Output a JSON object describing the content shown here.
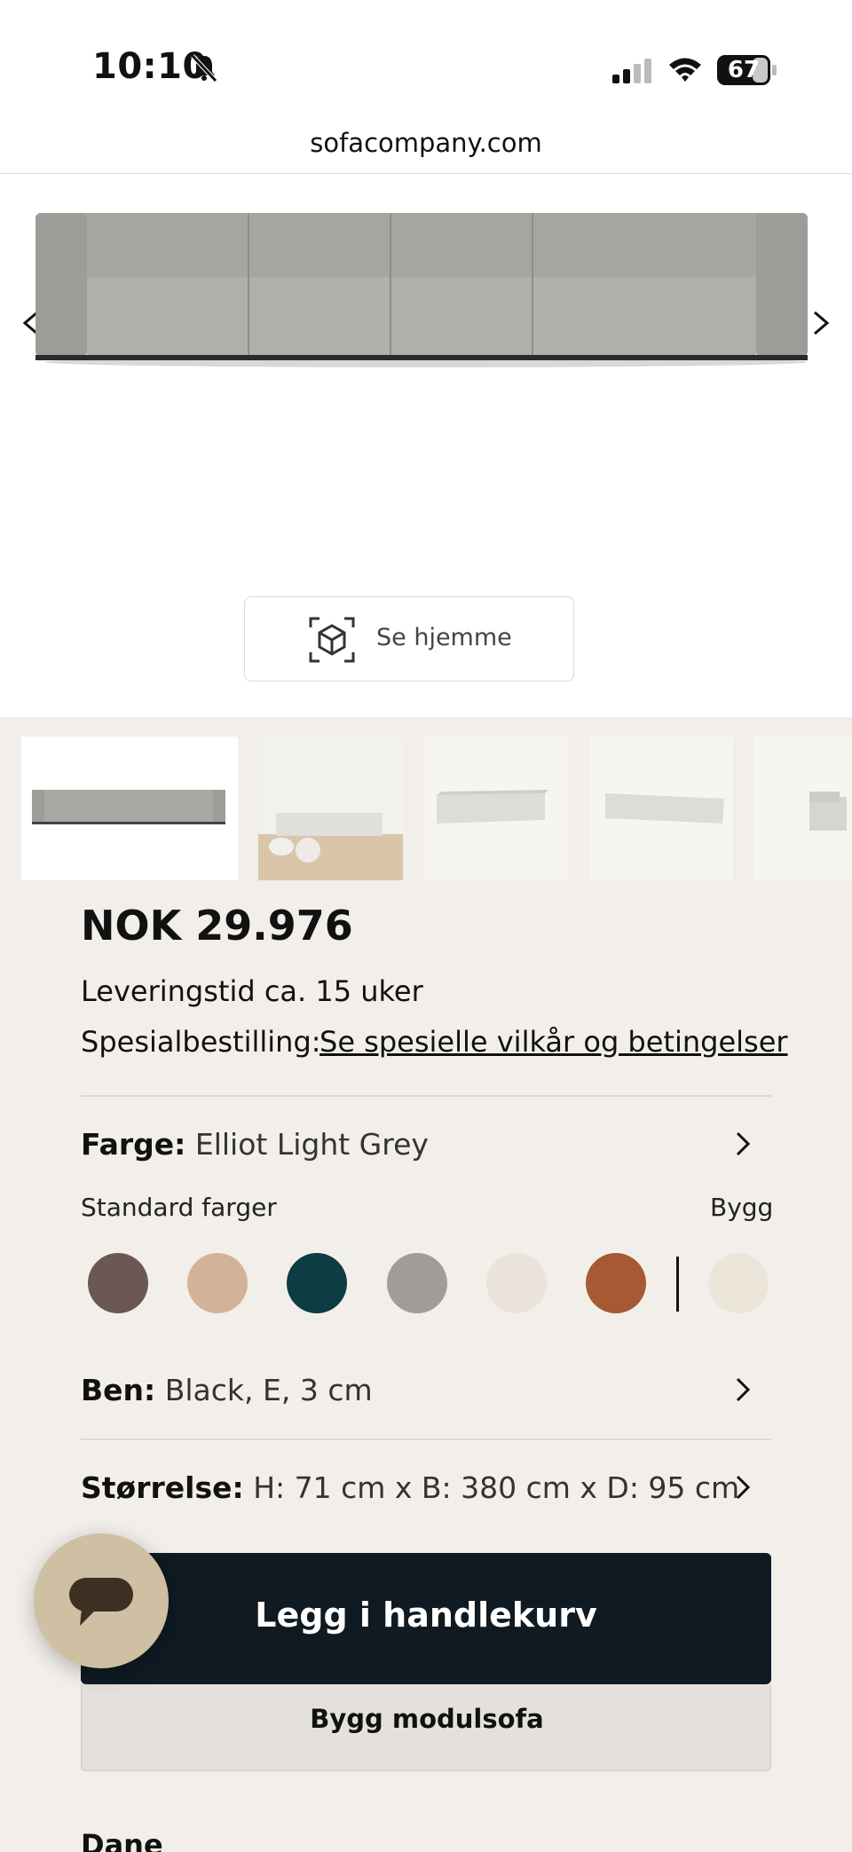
{
  "status_bar": {
    "time": "10:10",
    "battery": "67"
  },
  "browser": {
    "url": "sofacompany.com"
  },
  "hero": {
    "ar_button_label": "Se hjemme"
  },
  "product": {
    "price": "NOK 29.976",
    "delivery": "Leveringstid ca. 15 uker",
    "special_label": "Spesialbestilling:",
    "special_link": "Se spesielle vilkår og betingelser",
    "color_key": "Farge:",
    "color_value": "Elliot Light Grey",
    "standard_colors_label": "Standard farger",
    "build_label": "Bygg",
    "swatches": [
      "#6b5853",
      "#d2b39a",
      "#0d3c43",
      "#a09d98",
      "#ebe3da",
      "#a55a33",
      "#ece6da"
    ],
    "legs_key": "Ben:",
    "legs_value": "Black, E, 3 cm",
    "size_key": "Størrelse:",
    "size_value": "H: 71 cm x B: 380 cm x D: 95 cm",
    "add_to_cart": "Legg i handlekurv",
    "build_modular": "Bygg modulsofa",
    "next_section": "Dane"
  },
  "colors": {
    "cta_bg": "#0f1a22",
    "page_bg": "#f2efea",
    "chat_bg": "#cfbfa3",
    "sofa": "#a9a8a5"
  }
}
